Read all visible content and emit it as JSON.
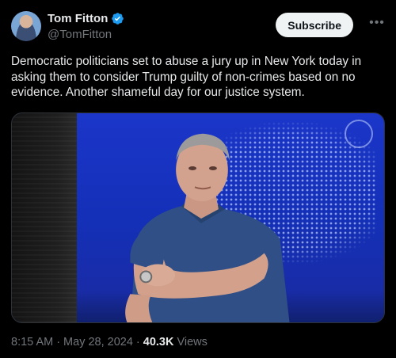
{
  "author": {
    "display_name": "Tom Fitton",
    "handle": "@TomFitton",
    "verified": true
  },
  "actions": {
    "subscribe_label": "Subscribe",
    "more_icon": "more-horizontal-icon"
  },
  "tweet": {
    "text": "Democratic politicians set to abuse a jury up in New York today in asking them to consider Trump guilty of non-crimes based on no evidence. Another shameful day for our justice system."
  },
  "meta": {
    "time": "8:15 AM",
    "separator": "·",
    "date": "May 28, 2024",
    "separator2": "·",
    "views_count": "40.3K",
    "views_label": "Views"
  },
  "colors": {
    "background": "#000000",
    "verified_blue": "#1d9bf0",
    "secondary_text": "#71767b",
    "primary_text": "#e7e9ea"
  }
}
